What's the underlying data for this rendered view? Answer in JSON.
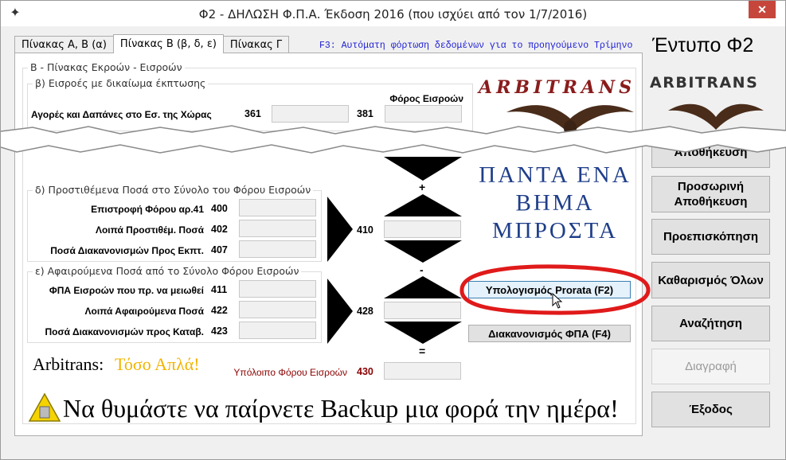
{
  "window": {
    "title": "Φ2 - ΔΗΛΩΣΗ Φ.Π.Α. Έκδοση 2016 (που ισχύει από τον 1/7/2016)",
    "close_label": "✕"
  },
  "tabs": [
    {
      "label": "Πίνακας Α, Β (α)"
    },
    {
      "label": "Πίνακας Β (β, δ, ε)"
    },
    {
      "label": "Πίνακας Γ"
    }
  ],
  "f3_hint": "F3: Αυτόματη φόρτωση δεδομένων για το προηγούμενο Τρίμηνο",
  "main_group_title": "Β - Πίνακας Εκροών - Εισροών",
  "section_b": {
    "title": "β) Εισροές με δικαίωμα έκπτωσης",
    "tax_header": "Φόρος Εισροών",
    "rows": [
      {
        "label": "Αγορές και Δαπάνες στο Εσ. της Χώρας",
        "code": "361",
        "tax_code": "381"
      }
    ]
  },
  "section_d": {
    "title": "δ) Προστιθέμενα Ποσά στο Σύνολο του Φόρου Εισροών",
    "rows": [
      {
        "label": "Επιστροφή Φόρου αρ.41",
        "code": "400"
      },
      {
        "label": "Λοιπά Προστιθέμ. Ποσά",
        "code": "402"
      },
      {
        "label": "Ποσά Διακανονισμών Προς Εκπτ.",
        "code": "407"
      }
    ],
    "total_code": "410"
  },
  "section_e": {
    "title": "ε) Αφαιρούμενα Ποσά από το Σύνολο Φόρου Εισροών",
    "rows": [
      {
        "label": "ΦΠΑ Εισροών που πρ. να μειωθεί",
        "code": "411"
      },
      {
        "label": "Λοιπά Αφαιρούμενα Ποσά",
        "code": "422"
      },
      {
        "label": "Ποσά Διακανονισμών προς Καταβ.",
        "code": "423"
      }
    ],
    "total_code": "428"
  },
  "operators": {
    "plus": "+",
    "minus": "-",
    "equals": "="
  },
  "remainder": {
    "label": "Υπόλοιπο Φόρου Εισροών",
    "code": "430"
  },
  "buttons": {
    "prorata": "Υπολογισμός Prorata (F2)",
    "vat_settlement": "Διακανονισμός ΦΠΑ (F4)"
  },
  "logo": {
    "script": "ARBITRANS",
    "slogan": [
      "ΠΑΝΤΑ ΕΝΑ",
      "ΒΗΜΑ",
      "ΜΠΡΟΣΤΑ"
    ]
  },
  "tagline": {
    "brand": "Arbitrans:",
    "simple": "Τόσο Απλά!"
  },
  "backup_message": "Να θυμάστε να παίρνετε Backup μια φορά την ημέρα!",
  "sidebar": {
    "form_title": "Έντυπο Φ2",
    "brand": "ARBITRANS",
    "partial_label": "Αποθήκευση",
    "buttons": [
      {
        "label": "Προσωρινή Αποθήκευση",
        "enabled": true
      },
      {
        "label": "Προεπισκόπηση",
        "enabled": true
      },
      {
        "label": "Καθαρισμός Όλων",
        "enabled": true
      },
      {
        "label": "Αναζήτηση",
        "enabled": true
      },
      {
        "label": "Διαγραφή",
        "enabled": false
      },
      {
        "label": "Έξοδος",
        "enabled": true
      }
    ]
  },
  "colors": {
    "accent_blue": "#1c1cd6",
    "slogan_blue": "#1f3e8a",
    "highlight_red": "#e01a1a",
    "remainder_red": "#8b0000",
    "tagline_yellow": "#f2b400"
  }
}
